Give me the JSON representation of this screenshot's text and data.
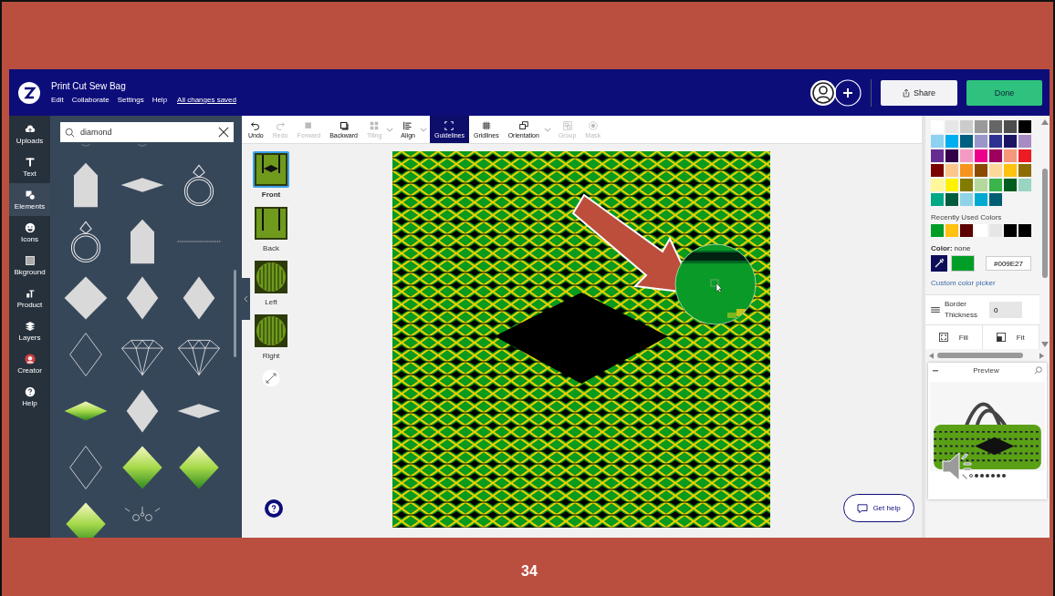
{
  "app": {
    "title": "Print Cut Sew Bag",
    "menu": [
      "Edit",
      "Collaborate",
      "Settings",
      "Help"
    ],
    "save_status": "All changes saved",
    "share": "Share",
    "done": "Done"
  },
  "rail": [
    {
      "kind": "upload",
      "label": "Uploads",
      "selected": false
    },
    {
      "kind": "text",
      "label": "Text",
      "selected": false
    },
    {
      "kind": "elements",
      "label": "Elements",
      "selected": true
    },
    {
      "kind": "smile",
      "label": "Icons",
      "selected": false
    },
    {
      "kind": "background",
      "label": "Bkground",
      "selected": false
    },
    {
      "kind": "product",
      "label": "Product",
      "selected": false
    },
    {
      "kind": "layers",
      "label": "Layers",
      "selected": false
    },
    {
      "kind": "avatar",
      "label": "Creator",
      "selected": false
    },
    {
      "kind": "help",
      "label": "Help",
      "selected": false
    }
  ],
  "search": {
    "value": "diamond"
  },
  "element_rows": [
    [
      {
        "kind": "arc"
      },
      {
        "kind": "arc"
      }
    ],
    [
      {
        "kind": "pentagon"
      },
      {
        "kind": "rhombus"
      },
      {
        "kind": "ring"
      }
    ],
    [
      {
        "kind": "ring"
      },
      {
        "kind": "pentagon"
      },
      {
        "kind": "line"
      }
    ],
    [
      {
        "kind": "square"
      },
      {
        "kind": "diamond"
      },
      {
        "kind": "diamond"
      }
    ],
    [
      {
        "kind": "outline"
      },
      {
        "kind": "gem"
      },
      {
        "kind": "gem"
      }
    ],
    [
      {
        "kind": "scene-rhombus"
      },
      {
        "kind": "diamond"
      },
      {
        "kind": "rhombus"
      }
    ],
    [
      {
        "kind": "outline"
      },
      {
        "kind": "scene-diamond"
      },
      {
        "kind": "scene-diamond"
      }
    ],
    [
      {
        "kind": "scene-diamond"
      },
      {
        "kind": "ornament"
      }
    ]
  ],
  "toolbar": [
    {
      "kind": "undo",
      "label": "Undo",
      "disabled": false,
      "selected": false,
      "menu": false
    },
    {
      "kind": "redo",
      "label": "Redo",
      "disabled": true,
      "selected": false,
      "menu": false
    },
    {
      "kind": "forward",
      "label": "Forward",
      "disabled": true,
      "selected": false,
      "menu": false
    },
    {
      "kind": "backward",
      "label": "Backward",
      "disabled": false,
      "selected": false,
      "menu": false
    },
    {
      "kind": "tiling",
      "label": "Tiling",
      "disabled": true,
      "selected": false,
      "menu": true
    },
    {
      "kind": "align",
      "label": "Align",
      "disabled": false,
      "selected": false,
      "menu": true
    },
    {
      "kind": "guidelines",
      "label": "Guidelines",
      "disabled": false,
      "selected": true,
      "menu": false
    },
    {
      "kind": "gridlines",
      "label": "Gridlines",
      "disabled": false,
      "selected": false,
      "menu": false
    },
    {
      "kind": "orientation",
      "label": "Orientation",
      "disabled": false,
      "selected": false,
      "menu": true
    },
    {
      "kind": "group",
      "label": "Group",
      "disabled": true,
      "selected": false,
      "menu": false
    },
    {
      "kind": "mask",
      "label": "Mask",
      "disabled": true,
      "selected": false,
      "menu": false
    }
  ],
  "pages": [
    {
      "kind": "front",
      "label": "Front",
      "selected": true
    },
    {
      "kind": "back",
      "label": "Back",
      "selected": false
    },
    {
      "kind": "round",
      "label": "Left",
      "selected": false
    },
    {
      "kind": "round",
      "label": "Right",
      "selected": false
    }
  ],
  "get_help": "Get help",
  "colors": {
    "swatches": [
      {
        "color": "#ffffff"
      },
      {
        "color": "#e6e6e6"
      },
      {
        "color": "#cccccc"
      },
      {
        "color": "#999999"
      },
      {
        "color": "#666666"
      },
      {
        "color": "#4d4d4d"
      },
      {
        "color": "#000000"
      },
      {
        "color": "#8ed1f0"
      },
      {
        "color": "#00aeef"
      },
      {
        "color": "#005f7f"
      },
      {
        "color": "#9b96c9"
      },
      {
        "color": "#2e3192"
      },
      {
        "color": "#1b1464"
      },
      {
        "color": "#a78bc4"
      },
      {
        "color": "#662d91"
      },
      {
        "color": "#32004b"
      },
      {
        "color": "#f49ac2"
      },
      {
        "color": "#ec008c"
      },
      {
        "color": "#9e005d"
      },
      {
        "color": "#f7977a"
      },
      {
        "color": "#ed1c24"
      },
      {
        "color": "#7b0000"
      },
      {
        "color": "#fbc68c"
      },
      {
        "color": "#f7941d"
      },
      {
        "color": "#8c4a00"
      },
      {
        "color": "#fdd89b"
      },
      {
        "color": "#ffc20e"
      },
      {
        "color": "#8c6d00"
      },
      {
        "color": "#fff799"
      },
      {
        "color": "#fff200"
      },
      {
        "color": "#827b00"
      },
      {
        "color": "#b5d99c"
      },
      {
        "color": "#39b54a"
      },
      {
        "color": "#005e20"
      },
      {
        "color": "#99d5c0"
      },
      {
        "color": "#00a885"
      },
      {
        "color": "#005b3f"
      },
      {
        "color": "#8fd3e6"
      },
      {
        "color": "#00a9d1"
      },
      {
        "color": "#005e73"
      }
    ],
    "recent_label": "Recently Used Colors",
    "recent": [
      {
        "color": "#009e27"
      },
      {
        "color": "#ffc20e"
      },
      {
        "color": "#5c0000"
      },
      {
        "color": "#ffffff"
      },
      {
        "color": "#e6e6e6"
      },
      {
        "color": "#000000"
      },
      {
        "color": "#000000"
      }
    ],
    "color_label": "Color:",
    "color_value": "none",
    "hex": "#009E27",
    "custom": "Custom color picker"
  },
  "border": {
    "label": "Border Thickness",
    "value": "0"
  },
  "fit_options": [
    {
      "kind": "fill",
      "label": "Fill"
    },
    {
      "kind": "fit",
      "label": "Fit"
    }
  ],
  "preview": {
    "title": "Preview",
    "dots": [
      {
        "selected": true
      },
      {
        "selected": false
      },
      {
        "selected": false
      },
      {
        "selected": false
      },
      {
        "selected": false
      },
      {
        "selected": false
      },
      {
        "selected": false
      }
    ]
  },
  "slide_number": "34"
}
